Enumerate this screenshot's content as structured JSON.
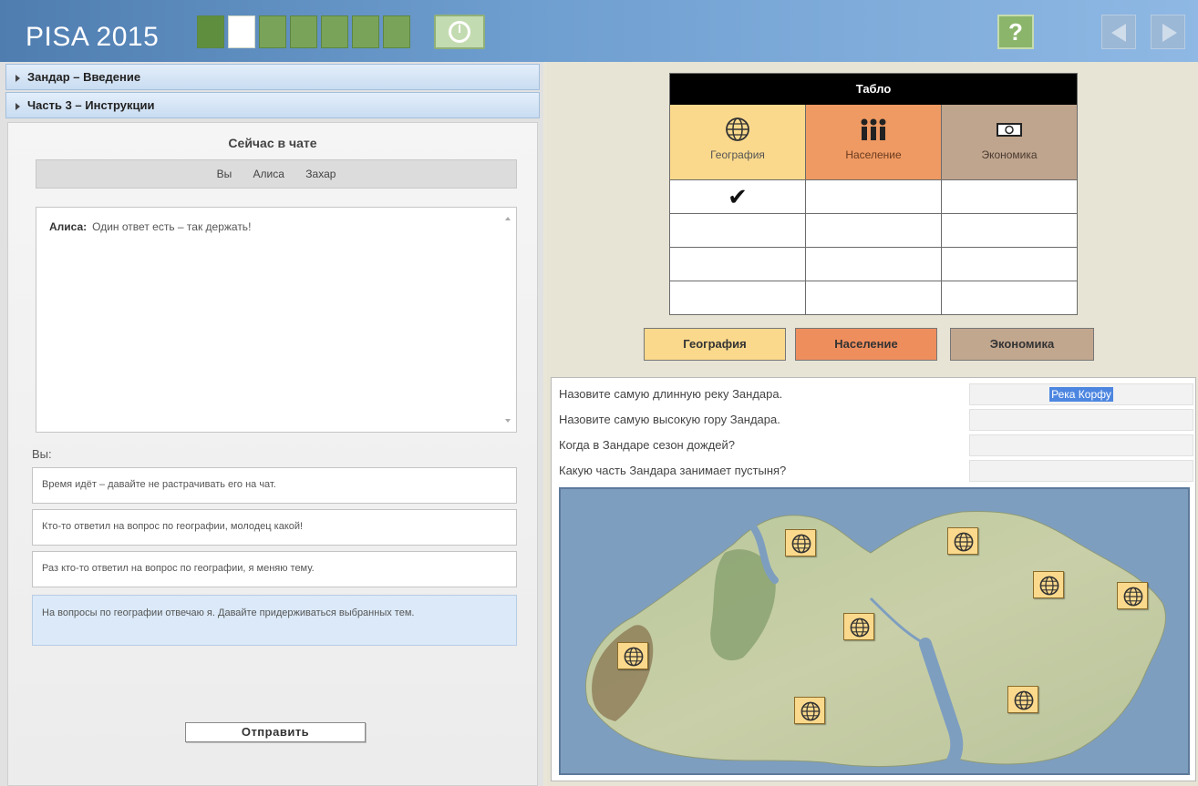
{
  "app": {
    "title": "PISA 2015",
    "progress": {
      "total": 7,
      "current": 2
    }
  },
  "nav": {
    "timer_icon": "clock-icon",
    "help_label": "?",
    "back_icon": "arrow-left-icon",
    "forward_icon": "arrow-right-icon"
  },
  "sidebar": {
    "accordion": [
      {
        "label": "Зандар – Введение"
      },
      {
        "label": "Часть 3 – Инструкции"
      }
    ]
  },
  "chat": {
    "title": "Сейчас в чате",
    "participants": [
      "Вы",
      "Алиса",
      "Захар"
    ],
    "messages": [
      {
        "author": "Алиса:",
        "text": "Один ответ есть – так держать!"
      }
    ],
    "you_label": "Вы:",
    "options": [
      {
        "text": "Время идёт – давайте не растрачивать его на чат."
      },
      {
        "text": "Кто-то ответил на вопрос по географии, молодец какой!"
      },
      {
        "text": "Раз кто-то ответил на вопрос по географии, я меняю тему."
      },
      {
        "text": "На вопросы по географии отвечаю я. Давайте придерживаться выбранных тем."
      }
    ],
    "selected_option": 3,
    "send_label": "Отправить"
  },
  "board": {
    "title": "Табло",
    "columns": [
      {
        "label": "География",
        "icon": "globe-icon",
        "color": "#fbd98c"
      },
      {
        "label": "Население",
        "icon": "people-icon",
        "color": "#ef9a62"
      },
      {
        "label": "Экономика",
        "icon": "money-icon",
        "color": "#bfa58e"
      }
    ],
    "rows": [
      [
        "✔",
        "",
        ""
      ],
      [
        "",
        "",
        ""
      ],
      [
        "",
        "",
        ""
      ],
      [
        "",
        "",
        ""
      ]
    ]
  },
  "topics": [
    {
      "label": "География"
    },
    {
      "label": "Население"
    },
    {
      "label": "Экономика"
    }
  ],
  "questions": [
    {
      "text": "Назовите самую длинную реку Зандара.",
      "answer": "Река Корфу"
    },
    {
      "text": "Назовите самую высокую гору Зандара.",
      "answer": ""
    },
    {
      "text": "Когда в Зандаре сезон дождей?",
      "answer": ""
    },
    {
      "text": "Какую часть Зандара занимает пустыня?",
      "answer": ""
    }
  ],
  "map": {
    "marker_icon": "globe-icon",
    "marker_count": 9
  }
}
